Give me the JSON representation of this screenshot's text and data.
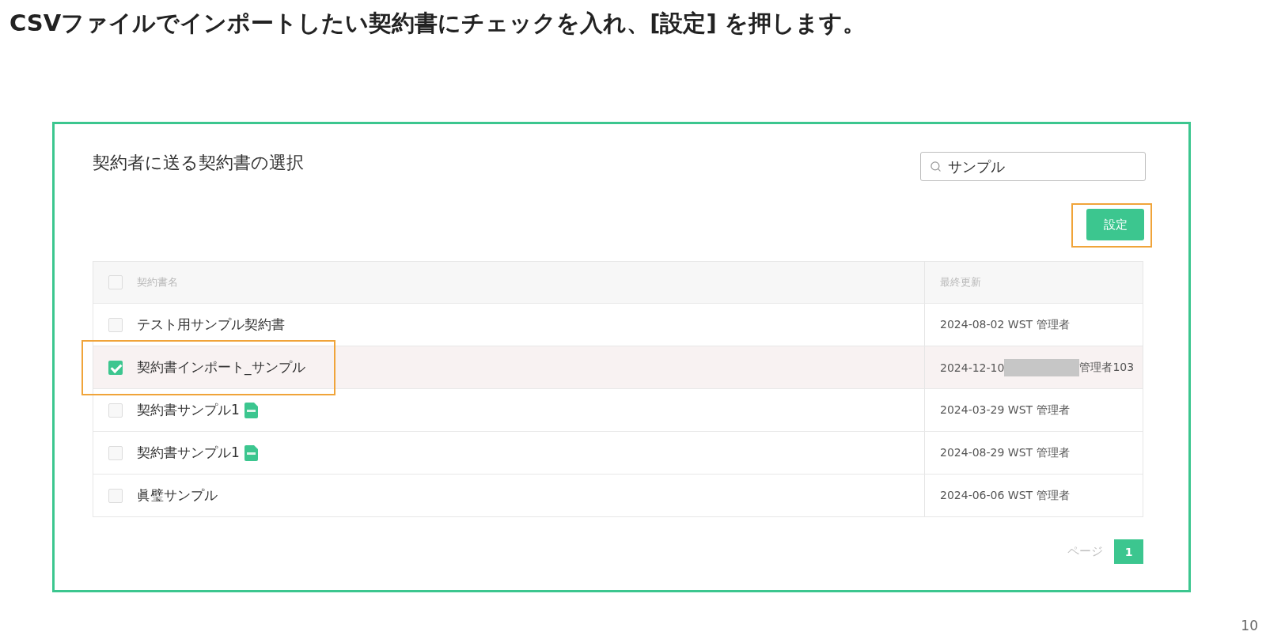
{
  "instruction": "CSVファイルでインポートしたい契約書にチェックを入れ、[設定] を押します。",
  "dialog": {
    "title": "契約者に送る契約書の選択",
    "search": {
      "value": "サンプル"
    },
    "set_button": {
      "label": "設定",
      "highlighted": true
    }
  },
  "table": {
    "select_all": {
      "checked": false
    },
    "columns": [
      "契約書名",
      "最終更新"
    ],
    "rows": [
      {
        "name": "テスト用サンプル契約書",
        "file_icon": false,
        "updated": [
          "2024-08-02 WST 管理者"
        ],
        "redacted": false,
        "checked": false,
        "highlighted": false
      },
      {
        "name": "契約書インポート_サンプル",
        "file_icon": false,
        "updated": [
          "2024-12-10",
          "管理者103"
        ],
        "redacted": true,
        "checked": true,
        "highlighted": true
      },
      {
        "name": "契約書サンプル1",
        "file_icon": true,
        "updated": [
          "2024-03-29 WST 管理者"
        ],
        "redacted": false,
        "checked": false,
        "highlighted": false
      },
      {
        "name": "契約書サンプル1",
        "file_icon": true,
        "updated": [
          "2024-08-29 WST 管理者"
        ],
        "redacted": false,
        "checked": false,
        "highlighted": false
      },
      {
        "name": "眞璧サンプル",
        "file_icon": false,
        "updated": [
          "2024-06-06 WST 管理者"
        ],
        "redacted": false,
        "checked": false,
        "highlighted": false
      }
    ]
  },
  "pagination": {
    "label": "ページ",
    "pages": [
      {
        "label": "1",
        "selected": true
      }
    ]
  },
  "page_number": "10"
}
